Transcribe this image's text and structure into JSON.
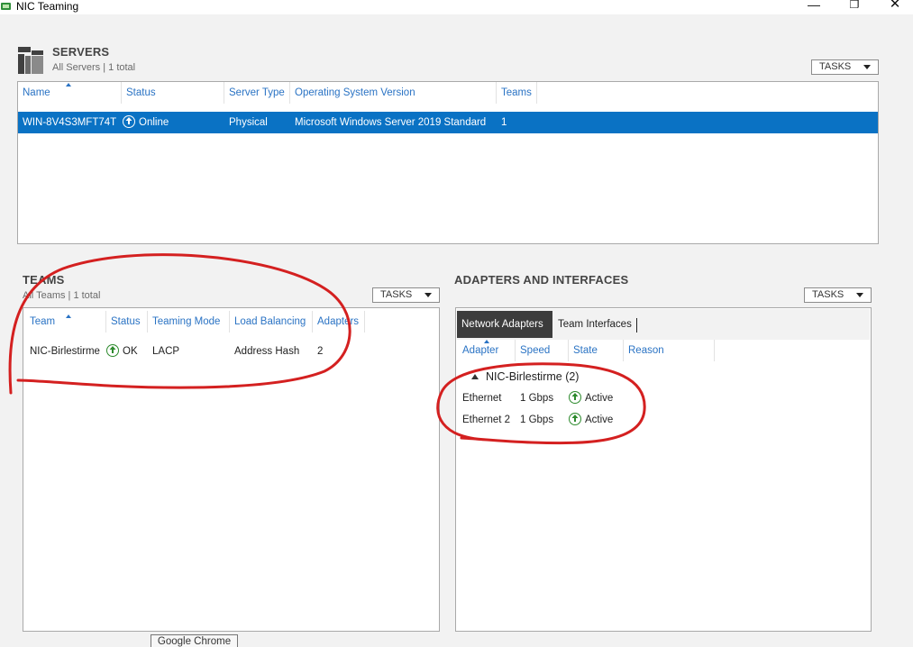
{
  "window": {
    "title": "NIC Teaming",
    "minimize_glyph": "—",
    "maximize_glyph": "❐",
    "close_glyph": "✕"
  },
  "servers": {
    "title": "SERVERS",
    "subtitle": "All Servers | 1 total",
    "tasks_label": "TASKS",
    "columns": [
      "Name",
      "Status",
      "Server Type",
      "Operating System Version",
      "Teams"
    ],
    "rows": [
      {
        "name": "WIN-8V4S3MFT74T",
        "status": "Online",
        "server_type": "Physical",
        "os_version": "Microsoft Windows Server 2019 Standard",
        "teams": "1"
      }
    ]
  },
  "teams": {
    "title": "TEAMS",
    "subtitle": "All Teams | 1 total",
    "tasks_label": "TASKS",
    "columns": [
      "Team",
      "Status",
      "Teaming Mode",
      "Load Balancing",
      "Adapters"
    ],
    "rows": [
      {
        "team": "NIC-Birlestirme",
        "status": "OK",
        "teaming_mode": "LACP",
        "load_balancing": "Address Hash",
        "adapters": "2"
      }
    ]
  },
  "adapters": {
    "title": "ADAPTERS AND INTERFACES",
    "tasks_label": "TASKS",
    "tabs": [
      "Network Adapters",
      "Team Interfaces"
    ],
    "active_tab": 0,
    "columns": [
      "Adapter",
      "Speed",
      "State",
      "Reason"
    ],
    "group": "NIC-Birlestirme (2)",
    "rows": [
      {
        "adapter": "Ethernet",
        "speed": "1 Gbps",
        "state": "Active",
        "reason": ""
      },
      {
        "adapter": "Ethernet 2",
        "speed": "1 Gbps",
        "state": "Active",
        "reason": ""
      }
    ]
  },
  "tooltip": {
    "text": "Google Chrome"
  },
  "colors": {
    "accent": "#0a72c4",
    "header_link": "#2a73c4",
    "status_green": "#2d8a2d",
    "annotation_red": "#d42020"
  },
  "icons": {
    "app": "nic-teaming-app-icon",
    "servers": "server-stack-icon",
    "status": "arrow-up-circle-icon",
    "expand": "collapse-triangle-icon",
    "dropdown": "caret-down-icon"
  }
}
